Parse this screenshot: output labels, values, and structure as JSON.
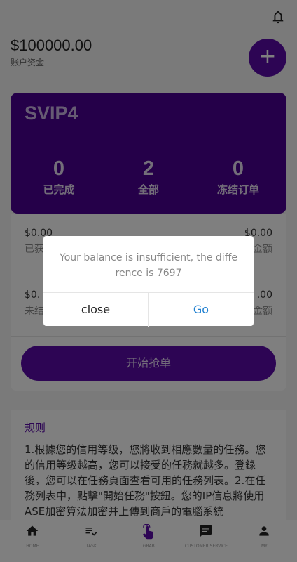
{
  "header": {
    "balance": "$100000.00",
    "balance_label": "账户资金",
    "add_symbol": "+"
  },
  "vip": {
    "title": "SVIP4",
    "stats": [
      {
        "value": "0",
        "label": "已完成"
      },
      {
        "value": "2",
        "label": "全部"
      },
      {
        "value": "0",
        "label": "冻结订单"
      }
    ]
  },
  "panel": {
    "rows": [
      {
        "left_amount": "$0.00",
        "left_label": "已获",
        "right_amount": "$0.00",
        "right_label": "金额"
      },
      {
        "left_amount": "$0.",
        "left_label": "未结",
        "right_amount": ".00",
        "right_label": "金额"
      }
    ],
    "grab_button": "开始抢单"
  },
  "rules": {
    "title": "规则",
    "text": "1.根據您的信用等级，您將收到相應數量的任務。您的信用等级越高，您可以接受的任務就越多。登錄後，您可以在任務頁面查看可用的任務列表。2.在任務列表中，點擊\"開始任務\"按鈕。您的IP信息將使用ASE加密算法加密并上傳到商戶的電腦系統"
  },
  "tabs": [
    {
      "label": "HOME",
      "icon": "home-icon"
    },
    {
      "label": "TASK",
      "icon": "task-list-icon"
    },
    {
      "label": "GRAB",
      "icon": "grab-hand-icon"
    },
    {
      "label": "CUSTOMER SERVICE",
      "icon": "chat-icon"
    },
    {
      "label": "MY",
      "icon": "person-icon"
    }
  ],
  "dialog": {
    "message": "Your balance is insufficient, the difference is 7697",
    "close_label": "close",
    "go_label": "Go"
  },
  "colors": {
    "primary": "#5a0aa8",
    "card": "#4b0092",
    "link": "#1e7fd0"
  }
}
